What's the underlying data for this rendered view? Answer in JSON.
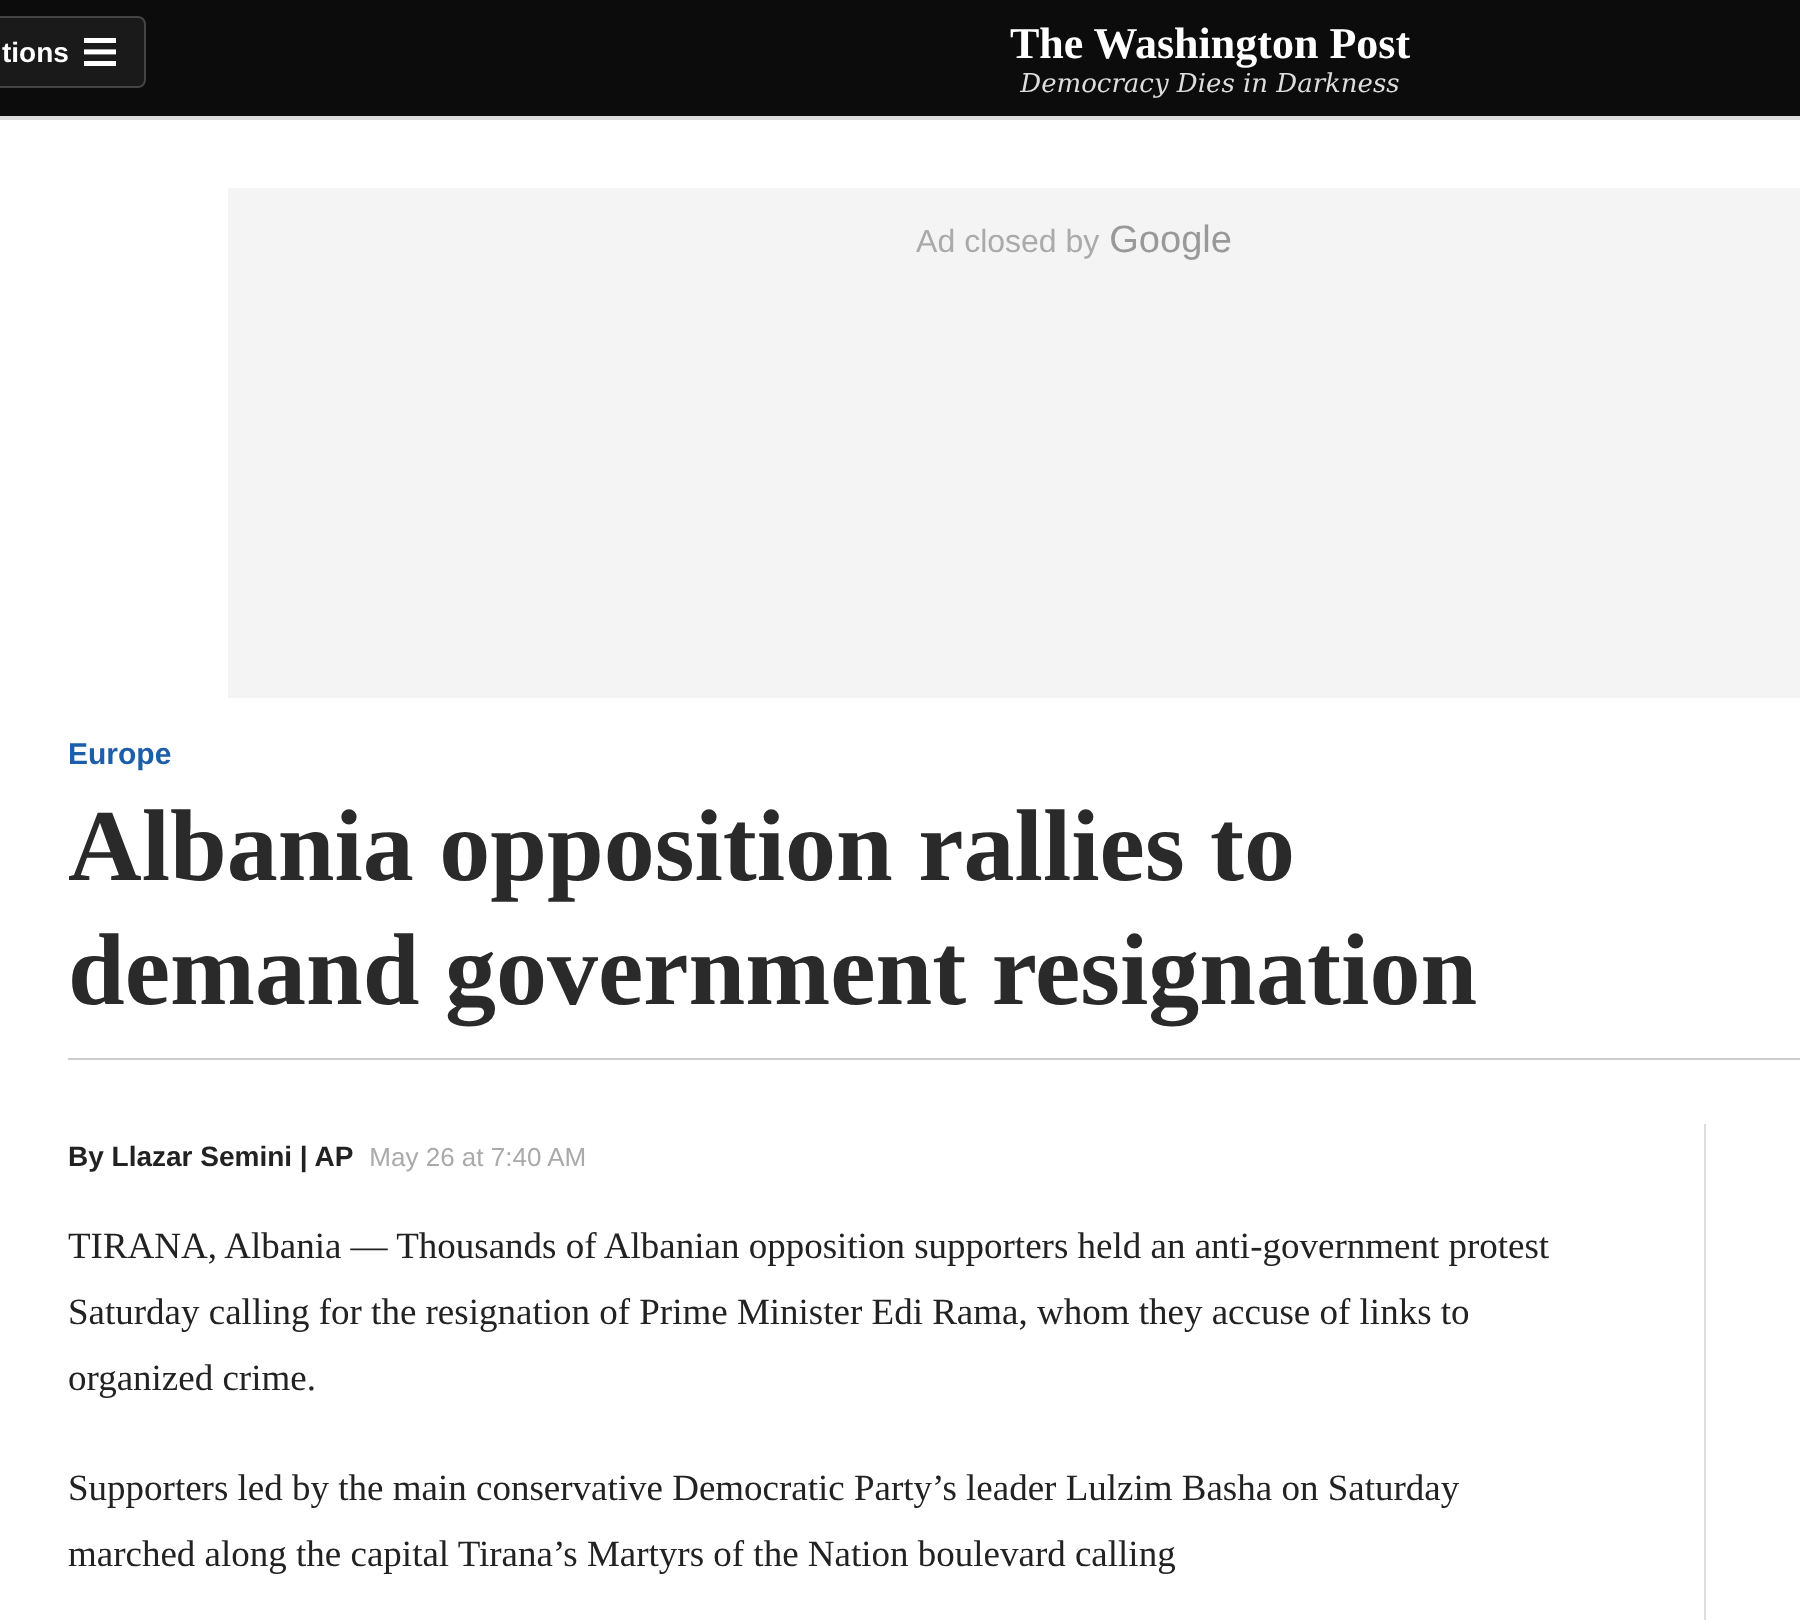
{
  "header": {
    "sections_button": "tions",
    "logo": "The Washington Post",
    "tagline": "Democracy Dies in Darkness"
  },
  "ad": {
    "text": "Ad closed by",
    "brand": "Google"
  },
  "article": {
    "kicker": "Europe",
    "headline": "Albania opposition rallies to demand government resignation",
    "byline": "By Llazar Semini | AP",
    "date": "May 26 at 7:40 AM",
    "paragraphs": [
      "TIRANA, Albania — Thousands of Albanian opposition supporters held an anti-government protest Saturday calling for the resignation of Prime Minister Edi Rama, whom they accuse of links to organized crime.",
      "Supporters led by the main conservative Democratic Party’s leader Lulzim Basha on Saturday marched along the capital Tirana’s Martyrs of the Nation boulevard calling"
    ]
  }
}
